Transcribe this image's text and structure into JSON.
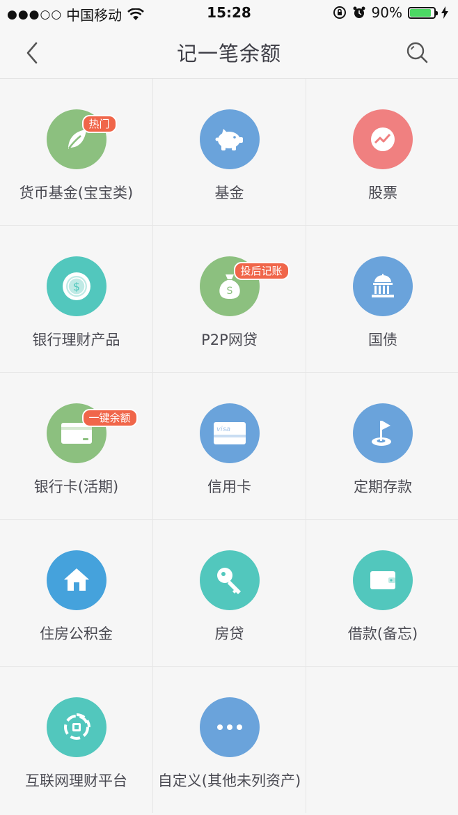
{
  "status_bar": {
    "signal": "●●●○○",
    "carrier": "中国移动",
    "time": "15:28",
    "battery_pct": "90%",
    "battery_level": 0.9
  },
  "nav": {
    "title": "记一笔余额"
  },
  "colors": {
    "green": "#8cc07f",
    "blue": "#6aa3db",
    "red": "#f08080",
    "teal": "#52c7bd",
    "house_blue": "#45a2dc",
    "badge": "#f0664a"
  },
  "items": [
    {
      "label": "货币基金(宝宝类)",
      "icon": "leaf-icon",
      "badge": "热门"
    },
    {
      "label": "基金",
      "icon": "piggy-bank-icon",
      "badge": ""
    },
    {
      "label": "股票",
      "icon": "stock-chart-icon",
      "badge": ""
    },
    {
      "label": "银行理财产品",
      "icon": "coin-icon",
      "badge": ""
    },
    {
      "label": "P2P网贷",
      "icon": "money-bag-icon",
      "badge": "投后记账"
    },
    {
      "label": "国债",
      "icon": "government-building-icon",
      "badge": ""
    },
    {
      "label": "银行卡(活期)",
      "icon": "bank-card-icon",
      "badge": "一键余额"
    },
    {
      "label": "信用卡",
      "icon": "credit-card-icon",
      "badge": ""
    },
    {
      "label": "定期存款",
      "icon": "flag-icon",
      "badge": ""
    },
    {
      "label": "住房公积金",
      "icon": "house-icon",
      "badge": ""
    },
    {
      "label": "房贷",
      "icon": "key-icon",
      "badge": ""
    },
    {
      "label": "借款(备忘)",
      "icon": "wallet-icon",
      "badge": ""
    },
    {
      "label": "互联网理财平台",
      "icon": "platform-icon",
      "badge": ""
    },
    {
      "label": "自定义(其他未列资产)",
      "icon": "more-icon",
      "badge": ""
    }
  ],
  "card_text": "visa",
  "coin_text": "$",
  "bag_text": "S"
}
